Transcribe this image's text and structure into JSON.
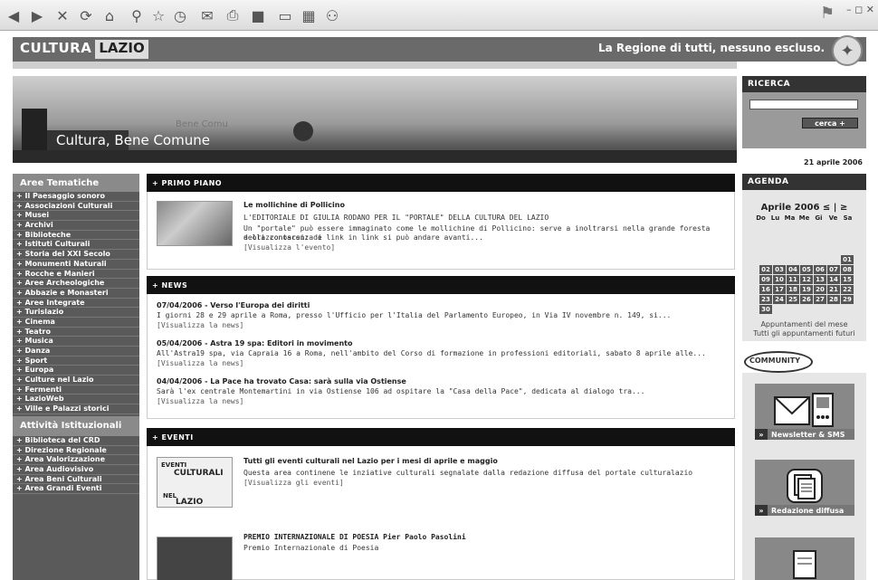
{
  "header": {
    "brand_a": "CULTURA",
    "brand_b": "LAZIO",
    "slogan": "La Regione di tutti, nessuno escluso."
  },
  "banner": {
    "title": "Cultura, Bene Comune",
    "ghost": "Bene Comu"
  },
  "search": {
    "title": "RICERCA",
    "button": "cerca +"
  },
  "date": "21 aprile 2006",
  "leftnav": {
    "title": "Aree Tematiche",
    "items": [
      "+ Il Paesaggio sonoro",
      "+ Associazioni Culturali",
      "+ Musei",
      "+ Archivi",
      "+ Biblioteche",
      "+ Istituti Culturali",
      "+ Storia del XXI Secolo",
      "+ Monumenti Naturali",
      "+ Rocche e Manieri",
      "+ Aree Archeologiche",
      "+ Abbazie e Monasteri",
      "+ Aree Integrate",
      "+ Turislazio",
      "+ Cinema",
      "+ Teatro",
      "+ Musica",
      "+ Danza",
      "+ Sport",
      "+ Europa",
      "+ Culture nel Lazio",
      "+ Fermenti",
      "+ LazioWeb",
      "+ Ville e Palazzi storici"
    ],
    "title2": "Attività Istituzionali",
    "items2": [
      "+ Biblioteca del CRD",
      "+ Direzione Regionale",
      "+ Area Valorizzazione",
      "+ Area Audiovisivo",
      "+ Area Beni Culturali",
      "+ Area Grandi Eventi"
    ]
  },
  "primo_piano": {
    "title": "+ PRIMO PIANO",
    "item_title": "Le mollichine di Pollicino",
    "subtitle": "L'EDITORIALE DI GIULIA RODANO PER IL \"PORTALE\" DELLA CULTURA DEL LAZIO",
    "text1": "Un \"portale\" può essere immaginato come le mollichine di Pollicino: serve a inoltrarsi nella grande foresta della conoscenza e",
    "text2": "a orizzontarsi: di link in link si può andare avanti...",
    "link": "[Visualizza l'evento]"
  },
  "news": {
    "title": "+ NEWS",
    "items": [
      {
        "title": "07/04/2006 - Verso l'Europa dei diritti",
        "text": "I giorni 28 e 29 aprile a Roma, presso l'Ufficio per l'Italia del Parlamento Europeo, in Via IV novembre n. 149, si...",
        "link": "[Visualizza la news]"
      },
      {
        "title": "05/04/2006 - Astra 19 spa: Editori in movimento",
        "text": "All'Astra19 spa, via Capraia 16 a Roma, nell'ambito del Corso di formazione in professioni editoriali, sabato 8 aprile alle...",
        "link": "[Visualizza la news]"
      },
      {
        "title": "04/04/2006 - La Pace ha trovato Casa: sarà sulla via Ostiense",
        "text": "Sarà l'ex centrale Montemartini in via Ostiense 106 ad ospitare la \"Casa della Pace\", dedicata al dialogo tra...",
        "link": "[Visualizza la news]"
      }
    ]
  },
  "eventi": {
    "title": "+ EVENTI",
    "thumb_a": "EVENTI",
    "thumb_b": "CULTURALI",
    "thumb_c": "NEL",
    "thumb_d": "LAZIO",
    "item_title": "Tutti gli eventi culturali nel Lazio per i mesi di aprile e maggio",
    "text": "Questa area continene le inziative culturali segnalate dalla redazione diffusa del portale culturalazio",
    "link": "[Visualizza gli eventi]",
    "item2_title": "PREMIO INTERNAZIONALE DI POESIA Pier Paolo Pasolini",
    "item2_text": "Premio Internazionale di Poesia"
  },
  "agenda": {
    "title": "AGENDA",
    "month": "Aprile 2006",
    "nav_prev": "≤",
    "nav_sep": "|",
    "nav_next": "≥",
    "days": [
      "Do",
      "Lu",
      "Ma",
      "Me",
      "Gi",
      "Ve",
      "Sa"
    ],
    "cells": [
      "",
      "",
      "",
      "",
      "",
      "",
      "01",
      "02",
      "03",
      "04",
      "05",
      "06",
      "07",
      "08",
      "09",
      "10",
      "11",
      "12",
      "13",
      "14",
      "15",
      "16",
      "17",
      "18",
      "19",
      "20",
      "21",
      "22",
      "23",
      "24",
      "25",
      "26",
      "27",
      "28",
      "29",
      "30",
      "",
      "",
      "",
      "",
      "",
      ""
    ],
    "link1": "Appuntamenti del mese",
    "link2": "Tutti gli appuntamenti futuri"
  },
  "community": {
    "title": "COMMUNITY",
    "label1": "Newsletter & SMS",
    "label2": "Redazione diffusa",
    "arrow": "»"
  }
}
